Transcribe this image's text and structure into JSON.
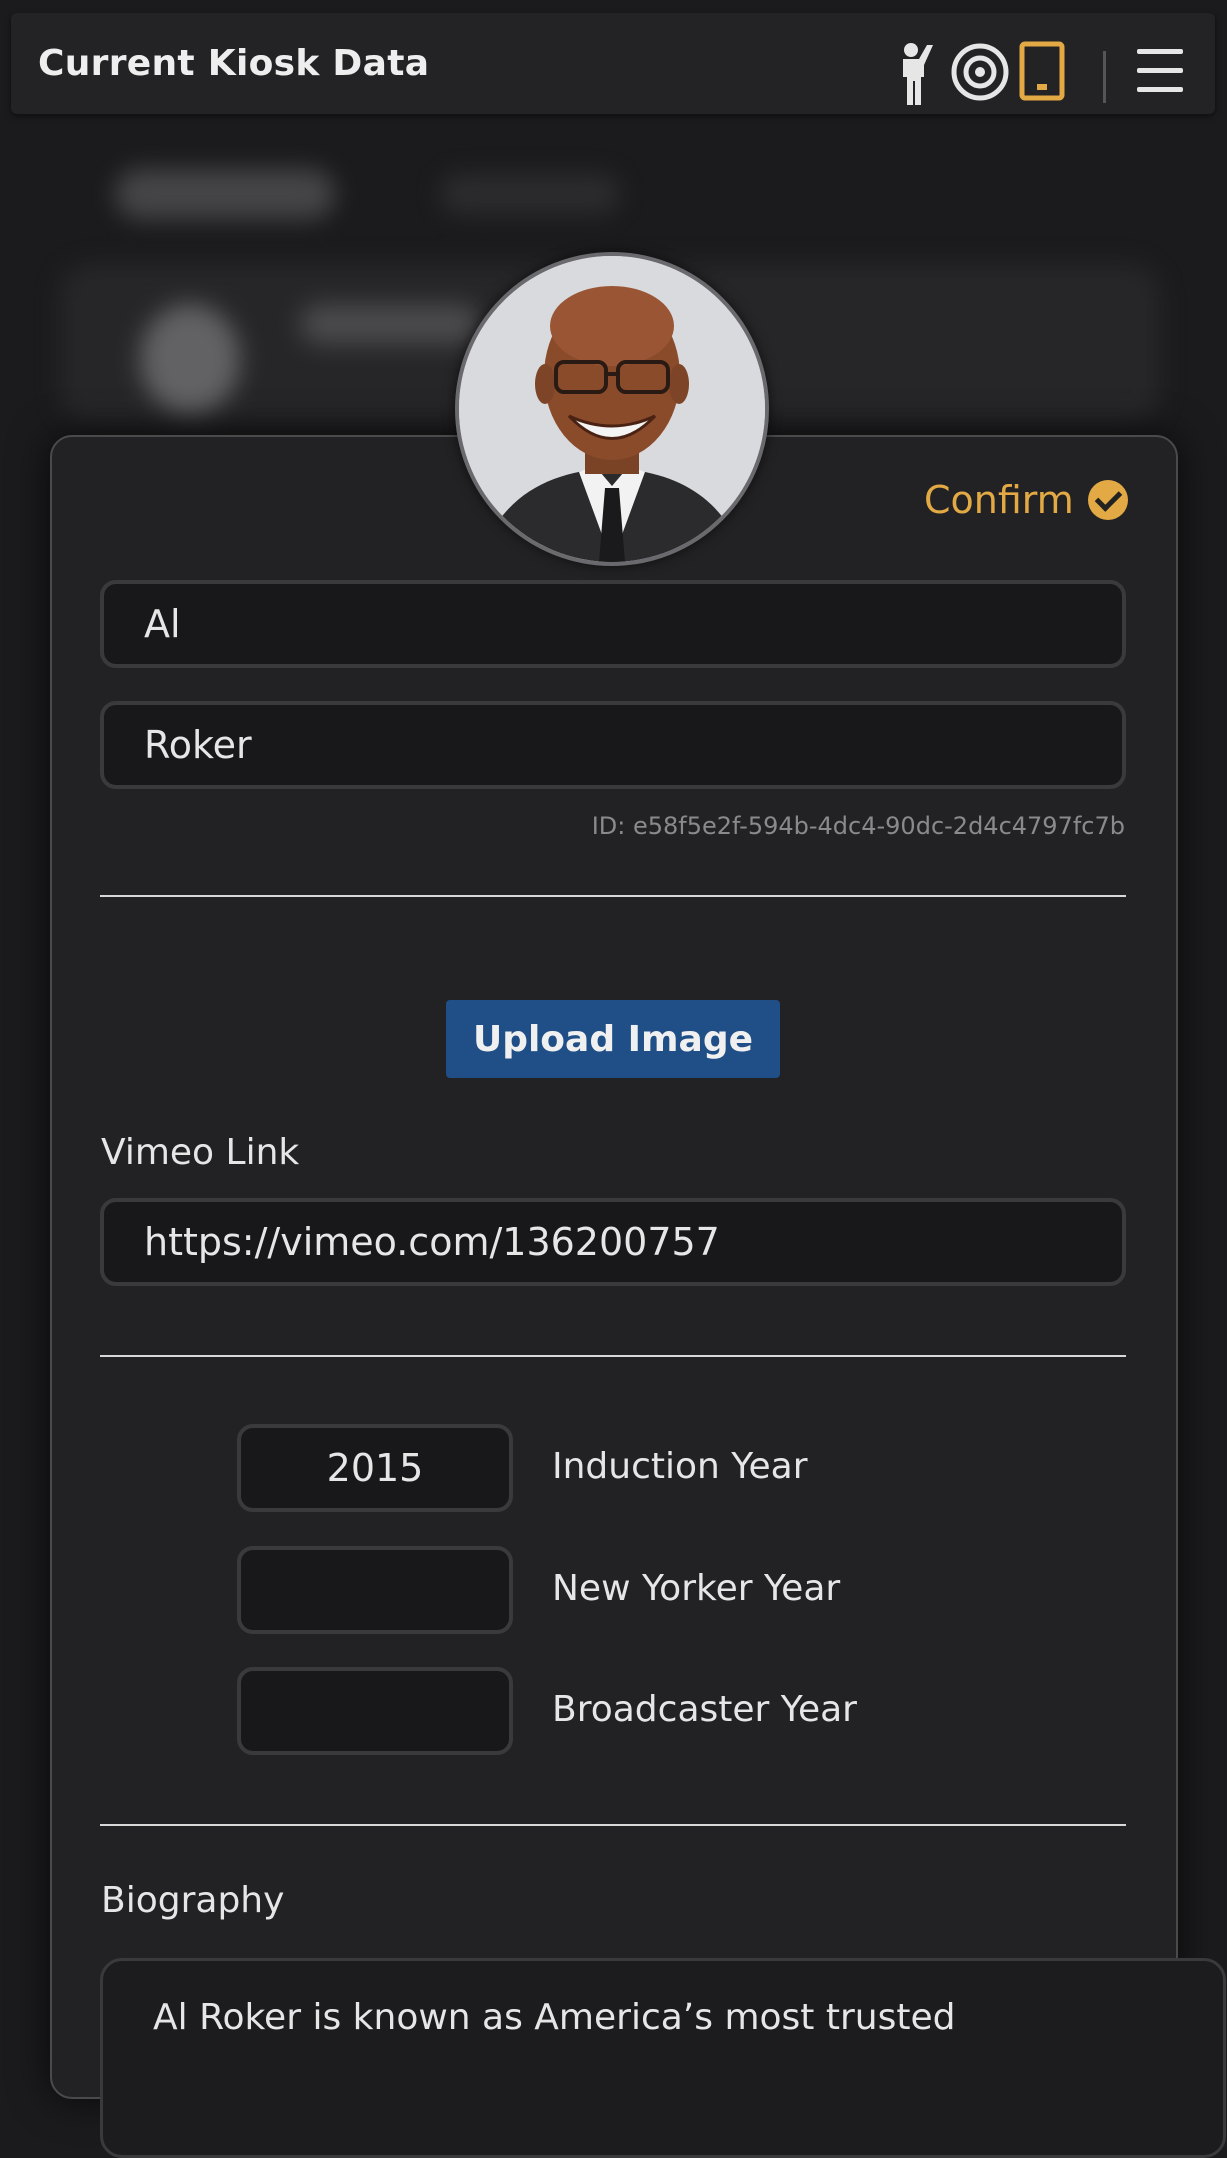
{
  "header": {
    "title": "Current Kiosk Data",
    "icons": [
      "person-waving-icon",
      "target-icon",
      "tablet-icon",
      "hamburger-menu-icon"
    ],
    "accent_color": "#e3a944"
  },
  "modal": {
    "confirm_label": "Confirm",
    "first_name": "Al",
    "last_name": "Roker",
    "id_text": "ID: e58f5e2f-594b-4dc4-90dc-2d4c4797fc7b",
    "upload_label": "Upload Image",
    "vimeo_label": "Vimeo Link",
    "vimeo_value": "https://vimeo.com/136200757",
    "years": [
      {
        "label": "Induction Year",
        "value": "2015"
      },
      {
        "label": "New Yorker Year",
        "value": ""
      },
      {
        "label": "Broadcaster Year",
        "value": ""
      }
    ],
    "biography_label": "Biography",
    "biography_text": "Al Roker is known as America’s most trusted"
  },
  "colors": {
    "background": "#1b1b1d",
    "upload_button": "#1f4f86",
    "confirm": "#e3a944"
  }
}
